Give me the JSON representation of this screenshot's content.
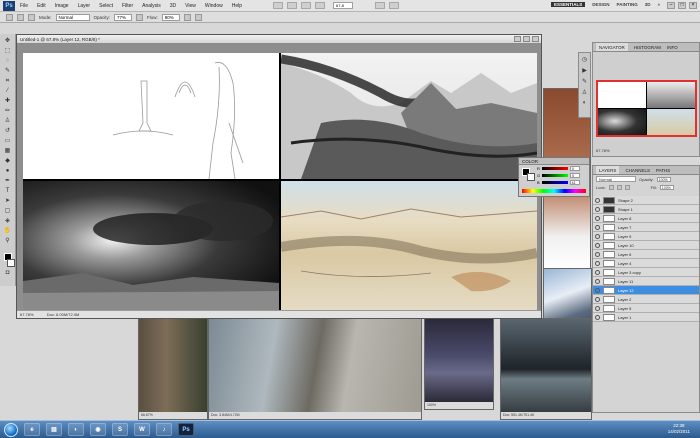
{
  "menubar": {
    "logo": "Ps",
    "items": [
      "File",
      "Edit",
      "Image",
      "Layer",
      "Select",
      "Filter",
      "Analysis",
      "3D",
      "View",
      "Window",
      "Help"
    ],
    "zoom": "67.8",
    "workspaces": [
      "ESSENTIALS",
      "DESIGN",
      "PAINTING",
      "3D"
    ],
    "more": "»"
  },
  "optbar": {
    "mode_label": "Mode:",
    "mode_value": "Normal",
    "opacity_label": "Opacity:",
    "opacity_value": "77%",
    "flow_label": "Flow:",
    "flow_value": "80%"
  },
  "document": {
    "title": "Untitled-1 @ 67.8% (Layer 12, RGB/8) *",
    "zoom": "67.78%",
    "doc_size": "Doc: 6.00M/72.0M"
  },
  "bg_windows": {
    "status_a": "66.67%",
    "status_b": "Doc: 3.84M/4.72M",
    "status_c": "66.67%",
    "status_d": "100%",
    "status_e": "Doc: 551.4K/751.4K"
  },
  "navigator": {
    "tabs": [
      "NAVIGATOR",
      "HISTOGRAM",
      "INFO"
    ],
    "zoom": "67.78%"
  },
  "color": {
    "title": "COLOR",
    "channels": [
      {
        "name": "R",
        "value": "0"
      },
      {
        "name": "G",
        "value": "0"
      },
      {
        "name": "B",
        "value": "41"
      }
    ]
  },
  "layers": {
    "tabs": [
      "LAYERS",
      "CHANNELS",
      "PATHS"
    ],
    "blend": "Normal",
    "opacity_label": "Opacity:",
    "opacity": "100%",
    "lock_label": "Lock:",
    "fill_label": "Fill:",
    "fill": "100%",
    "items": [
      {
        "name": "Shape 2",
        "dark": true
      },
      {
        "name": "Shape 1",
        "dark": true
      },
      {
        "name": "Layer 8",
        "dark": false
      },
      {
        "name": "Layer 7",
        "dark": false
      },
      {
        "name": "Layer 9",
        "dark": false
      },
      {
        "name": "Layer 10",
        "dark": false
      },
      {
        "name": "Layer 6",
        "dark": false
      },
      {
        "name": "Layer 4",
        "dark": false
      },
      {
        "name": "Layer 3 copy",
        "dark": false
      },
      {
        "name": "Layer 11",
        "dark": false
      },
      {
        "name": "Layer 12",
        "dark": false,
        "active": true
      },
      {
        "name": "Layer 2",
        "dark": false
      },
      {
        "name": "Layer 5",
        "dark": false
      },
      {
        "name": "Layer 1",
        "dark": false
      }
    ]
  },
  "taskbar": {
    "apps": [
      "e",
      "▤",
      "◐",
      "◉",
      "S",
      "W",
      "♪",
      "Ps"
    ],
    "time": "22:38",
    "date": "14/02/2011"
  }
}
